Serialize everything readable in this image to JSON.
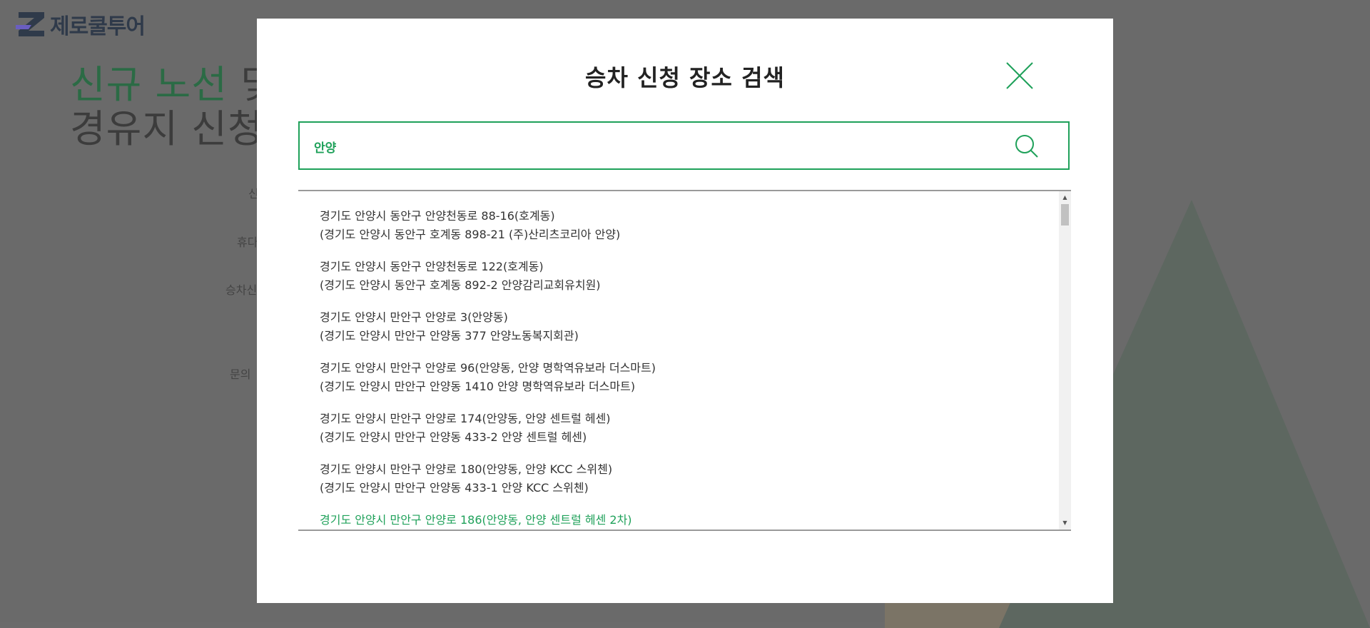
{
  "background": {
    "logo_text": "제로쿨투어",
    "hero": {
      "accent": "신규 노선",
      "rest1": " 및",
      "line2": "경유지 신청"
    },
    "labels": [
      "신",
      "휴다",
      "승차신",
      "문의"
    ]
  },
  "modal": {
    "title": "승차 신청 장소 검색",
    "close_icon": "close-icon",
    "search": {
      "value": "안양",
      "icon": "search-icon"
    },
    "results": [
      {
        "road": "경기도 안양시 동안구 안양천동로 88-16(호계동)",
        "lot": "(경기도 안양시 동안구 호계동 898-21 (주)산리츠코리아 안양)"
      },
      {
        "road": "경기도 안양시 동안구 안양천동로 122(호계동)",
        "lot": "(경기도 안양시 동안구 호계동 892-2 안양감리교회유치원)"
      },
      {
        "road": "경기도 안양시 만안구 안양로 3(안양동)",
        "lot": "(경기도 안양시 만안구 안양동 377 안양노동복지회관)"
      },
      {
        "road": "경기도 안양시 만안구 안양로 96(안양동, 안양 명학역유보라 더스마트)",
        "lot": "(경기도 안양시 만안구 안양동 1410 안양 명학역유보라 더스마트)"
      },
      {
        "road": "경기도 안양시 만안구 안양로 174(안양동, 안양 센트럴 헤센)",
        "lot": "(경기도 안양시 만안구 안양동 433-2 안양 센트럴 헤센)"
      },
      {
        "road": "경기도 안양시 만안구 안양로 180(안양동, 안양 KCC 스위첸)",
        "lot": "(경기도 안양시 만안구 안양동 433-1 안양 KCC 스위첸)"
      },
      {
        "road": "경기도 안양시 만안구 안양로 186(안양동, 안양 센트럴 헤센 2차)",
        "lot": ""
      }
    ],
    "active_index": 6
  },
  "colors": {
    "accent": "#1fa15a",
    "overlay": "#6a6a6a"
  }
}
